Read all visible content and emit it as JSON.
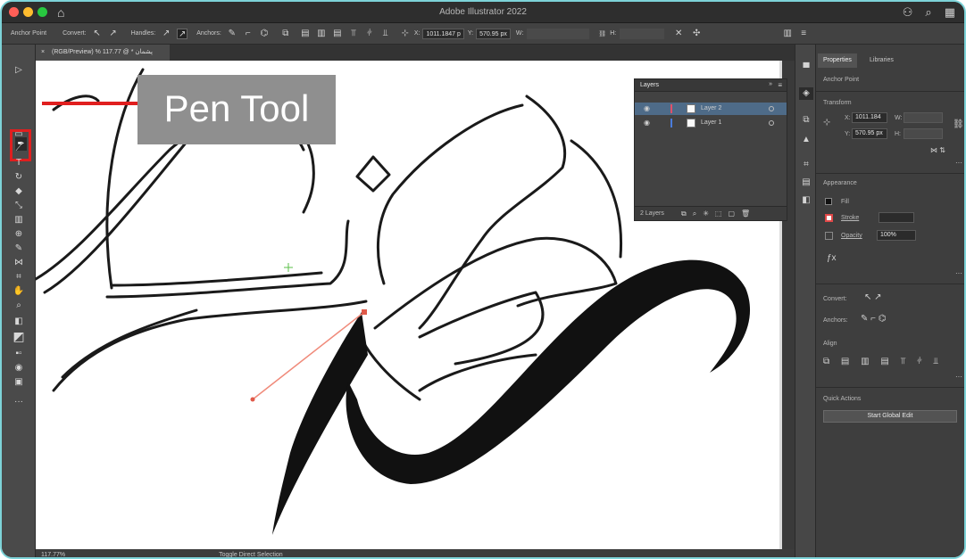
{
  "window": {
    "title": "Adobe Illustrator 2022"
  },
  "control_bar": {
    "anchor_point_label": "Anchor Point",
    "convert_label": "Convert:",
    "handles_label": "Handles:",
    "anchors_label": "Anchors:",
    "x_label": "X:",
    "x_value": "1011.1847 p",
    "y_label": "Y:",
    "y_value": "570.95 px",
    "w_label": "W:",
    "h_label": "H:"
  },
  "document_tab": {
    "label": "(RGB/Preview) % 117.77 @ * پشمان"
  },
  "callout": {
    "text": "Pen Tool"
  },
  "layers_panel": {
    "title": "Layers",
    "rows": [
      {
        "name": "Layer 2",
        "color": "#e0506a"
      },
      {
        "name": "Layer 1",
        "color": "#4a7cdc"
      }
    ],
    "footer_count": "2 Layers"
  },
  "properties_panel": {
    "tabs": [
      "Properties",
      "Libraries"
    ],
    "section_anchor_point": "Anchor Point",
    "section_transform": "Transform",
    "x_label": "X:",
    "x_value": "1011.184",
    "y_label": "Y:",
    "y_value": "570.95 px",
    "w_label": "W:",
    "h_label": "H:",
    "section_appearance": "Appearance",
    "fill_label": "Fill",
    "stroke_label": "Stroke",
    "opacity_label": "Opacity",
    "opacity_value": "100%",
    "convert_label": "Convert:",
    "anchors_label": "Anchors:",
    "section_align": "Align",
    "section_quick_actions": "Quick Actions",
    "start_global_edit": "Start Global Edit"
  },
  "status_bar": {
    "zoom": "117.77%",
    "mode": "Toggle Direct Selection"
  },
  "colors": {
    "accent_red": "#e01f1f",
    "frame_border": "#7dd3d8",
    "selection_blue": "#4e6b88"
  }
}
